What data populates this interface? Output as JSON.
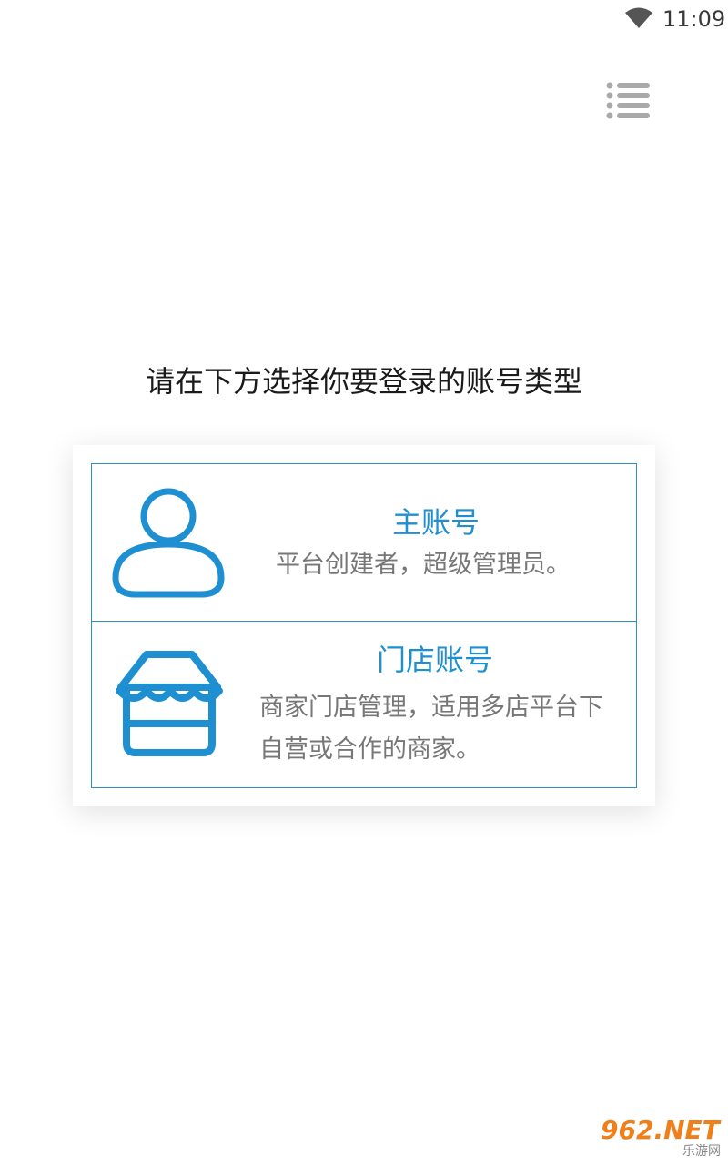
{
  "status_bar": {
    "time": "11:09",
    "wifi_icon": "wifi-icon"
  },
  "header": {
    "menu_icon": "list-menu-icon"
  },
  "prompt": "请在下方选择你要登录的账号类型",
  "accounts": [
    {
      "icon": "user-icon",
      "title": "主账号",
      "description": "平台创建者，超级管理员。"
    },
    {
      "icon": "store-icon",
      "title": "门店账号",
      "description": "商家门店管理，适用多店平台下自营或合作的商家。"
    }
  ],
  "watermark": {
    "brand": "962.NET",
    "subtitle": "乐游网"
  },
  "colors": {
    "accent": "#1e8fd0",
    "border": "#2d8fc6",
    "text_secondary": "#777777",
    "watermark": "#f07f1a"
  }
}
